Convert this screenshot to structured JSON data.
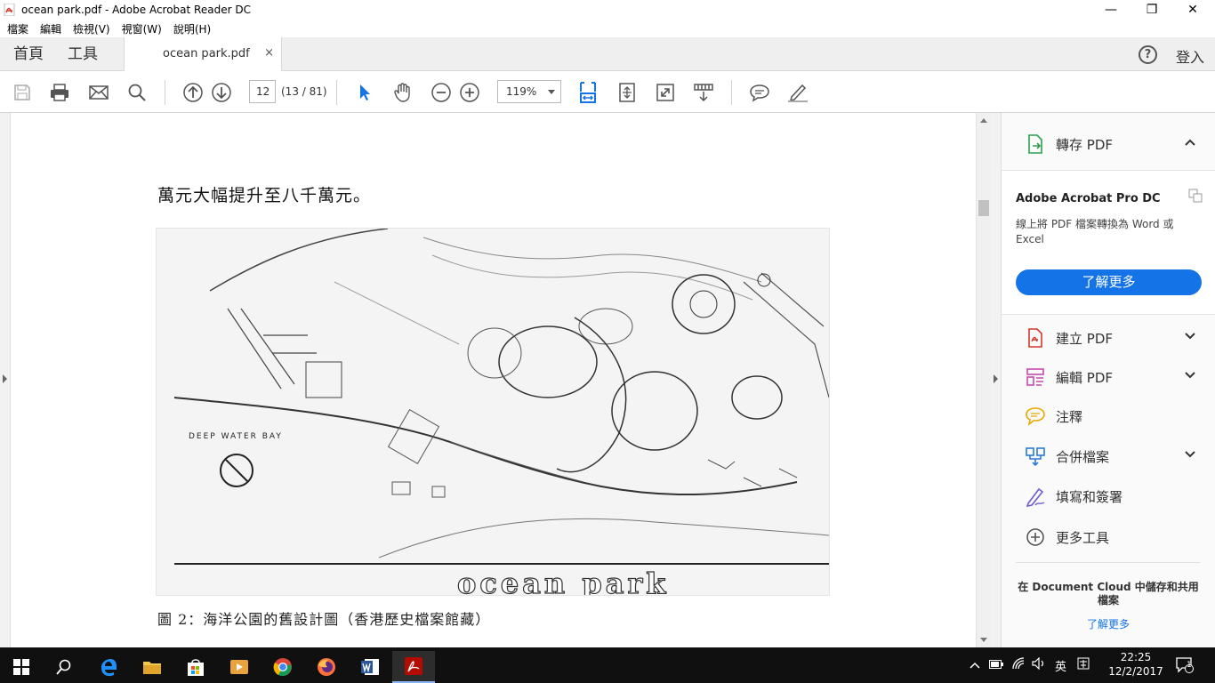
{
  "window": {
    "title": "ocean park.pdf - Adobe Acrobat Reader DC",
    "controls": {
      "minimize": "—",
      "maximize": "❐",
      "close": "✕"
    }
  },
  "menubar": {
    "items": [
      "檔案",
      "編輯",
      "檢視(V)",
      "視窗(W)",
      "說明(H)"
    ]
  },
  "tabs": {
    "home": "首頁",
    "tools": "工具",
    "document": "ocean park.pdf",
    "close": "×",
    "help": "?",
    "signin": "登入"
  },
  "toolbar": {
    "page_number": "12",
    "page_count": "(13 / 81)",
    "zoom": "119%"
  },
  "document": {
    "body_text": "萬元大幅提升至八千萬元。",
    "figure_labels": {
      "bay": "DEEP WATER BAY",
      "wordmark": "ocean park"
    },
    "caption": "圖 2：海洋公園的舊設計圖（香港歷史檔案館藏）"
  },
  "pane": {
    "export_pdf": "轉存 PDF",
    "promo_title": "Adobe Acrobat Pro DC",
    "promo_desc": "線上將 PDF 檔案轉換為 Word 或 Excel",
    "promo_button": "了解更多",
    "tools": [
      {
        "label": "建立 PDF",
        "icon": "create-pdf-icon"
      },
      {
        "label": "編輯 PDF",
        "icon": "edit-pdf-icon"
      },
      {
        "label": "注釋",
        "icon": "comment-icon"
      },
      {
        "label": "合併檔案",
        "icon": "combine-files-icon"
      },
      {
        "label": "填寫和簽署",
        "icon": "fill-sign-icon"
      },
      {
        "label": "更多工具",
        "icon": "more-tools-icon"
      }
    ],
    "cloud_text": "在 Document Cloud 中儲存和共用檔案",
    "cloud_link": "了解更多"
  },
  "taskbar": {
    "ime": "英",
    "time": "22:25",
    "date": "12/2/2017",
    "notifications": "1"
  },
  "colors": {
    "accent": "#1473e6",
    "taskbar": "#101010",
    "pdf_red": "#d4382c"
  }
}
